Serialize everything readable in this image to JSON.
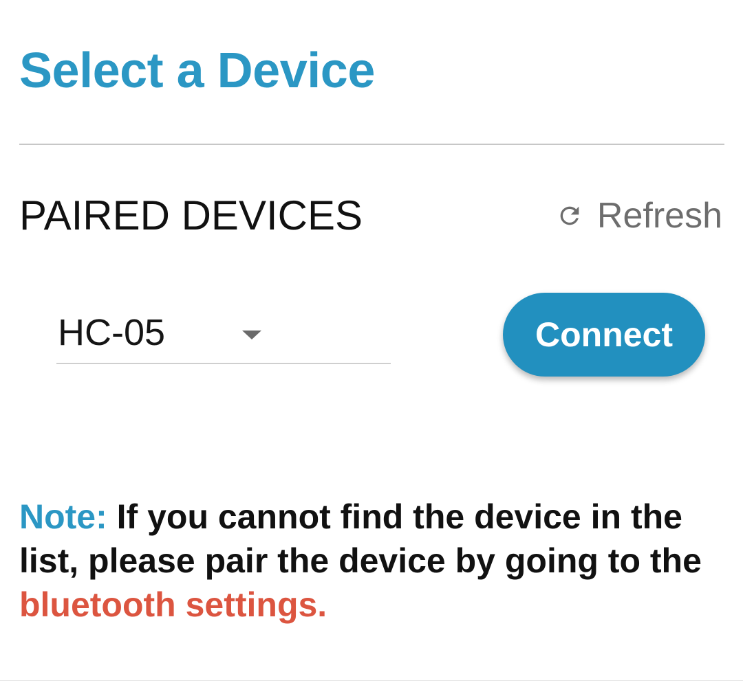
{
  "header": {
    "title": "Select a Device"
  },
  "paired_devices": {
    "section_title": "PAIRED DEVICES",
    "refresh_label": "Refresh",
    "selected_device": "HC-05",
    "connect_label": "Connect"
  },
  "note": {
    "label": "Note:",
    "text": " If you cannot find the device in the list, please pair the device by going to the ",
    "link_text": "bluetooth settings."
  },
  "colors": {
    "accent": "#2b97c4",
    "button": "#2290bf",
    "link": "#dc5540"
  },
  "icons": {
    "refresh": "refresh-icon",
    "dropdown": "caret-down-icon"
  }
}
